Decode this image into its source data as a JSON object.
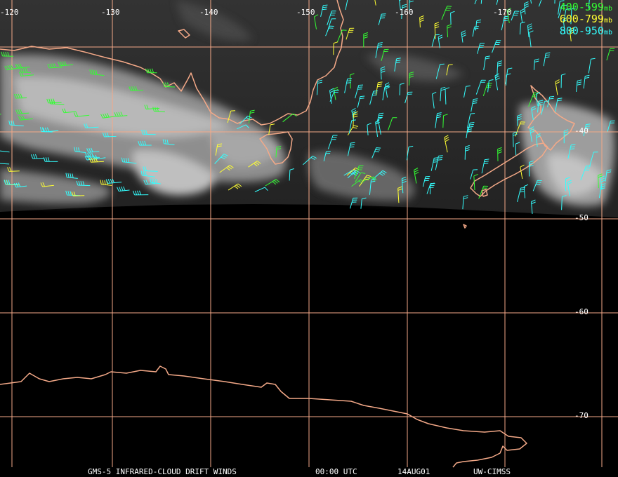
{
  "map": {
    "longitude_labels": [
      "-120",
      "-130",
      "-140",
      "-150",
      "-160",
      "-170"
    ],
    "latitude_labels": [
      "-40",
      "-50",
      "-60",
      "-70"
    ],
    "grid_color": "#f4a988",
    "coast_color": "#f4a988"
  },
  "legend": [
    {
      "range": "400-599",
      "unit": "mb",
      "color": "#33ff33"
    },
    {
      "range": "600-799",
      "unit": "mb",
      "color": "#ffff33"
    },
    {
      "range": "800-950",
      "unit": "mb",
      "color": "#33ffff"
    }
  ],
  "caption": {
    "product": "GMS-5 INFRARED-CLOUD DRIFT WINDS",
    "time": "00:00 UTC",
    "date": "14AUG01",
    "source": "UW-CIMSS"
  }
}
